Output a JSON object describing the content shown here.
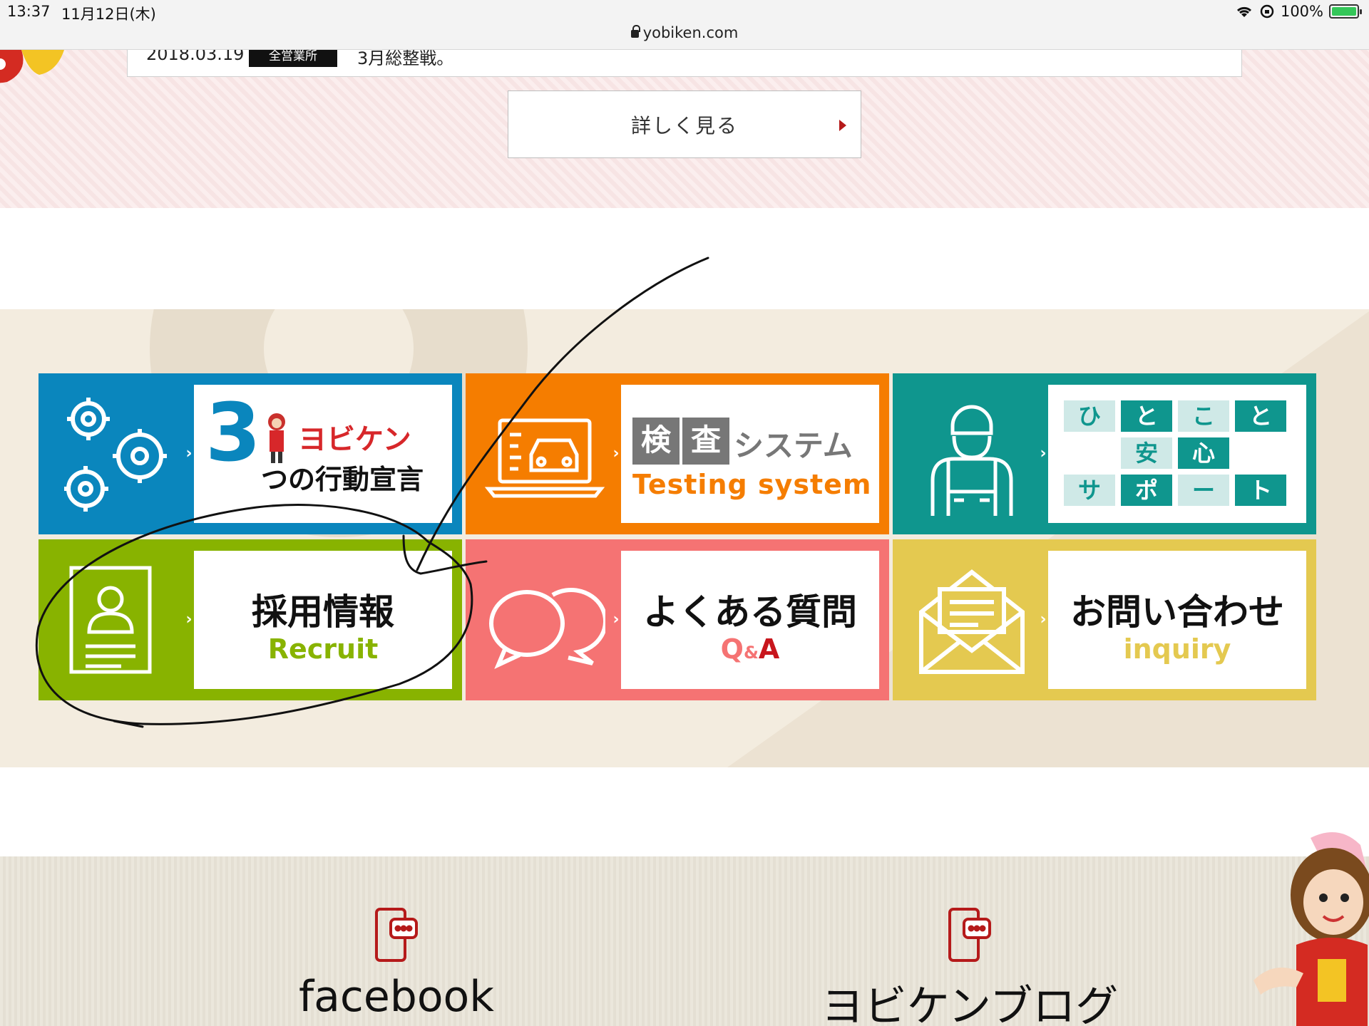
{
  "status": {
    "time": "13:37",
    "date": "11月12日(木)",
    "battery": "100%",
    "url": "yobiken.com",
    "battery_level": 1.0
  },
  "news": {
    "date": "2018.03.19",
    "category": "全営業所",
    "title": "3月総整戦。",
    "more_label": "詳しく見る"
  },
  "tiles": {
    "action": {
      "num": "3",
      "line1": "ヨビケン",
      "line2": "つの行動宣言"
    },
    "testing": {
      "k1": "検",
      "k2": "査",
      "sys": "システム",
      "en": "Testing system"
    },
    "support": {
      "grid": [
        [
          "ひ",
          "と",
          "こ",
          "と"
        ],
        [
          "",
          "安",
          "心",
          ""
        ],
        [
          "サ",
          "ポ",
          "ー",
          "ト"
        ]
      ]
    },
    "recruit": {
      "main": "採用情報",
      "sub": "Recruit"
    },
    "faq": {
      "main": "よくある質問",
      "sub_q": "Q",
      "sub_amp": "&",
      "sub_a": "A"
    },
    "inquiry": {
      "main": "お問い合わせ",
      "sub": "inquiry"
    }
  },
  "social": {
    "facebook": "facebook",
    "blog": "ヨビケンブログ"
  },
  "colors": {
    "action": "#0a86bd",
    "testing": "#f57d00",
    "support": "#0f968e",
    "recruit": "#88b300",
    "faq": "#f57373",
    "inquiry": "#e4c950",
    "brand_red": "#b51a1a"
  },
  "icons": [
    "wifi-icon",
    "rotation-lock-icon",
    "battery-icon",
    "lock-icon",
    "chevron-right-icon",
    "gears-icon",
    "laptop-car-icon",
    "mechanic-icon",
    "resume-icon",
    "speech-bubbles-icon",
    "envelope-icon",
    "smartphone-chat-icon"
  ]
}
